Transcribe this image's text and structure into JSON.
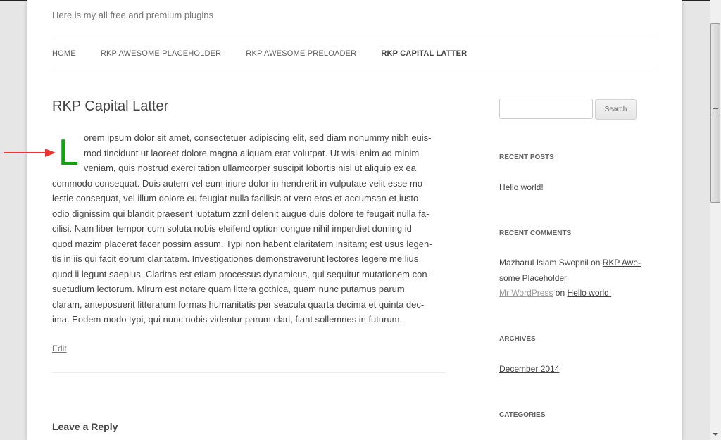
{
  "header": {
    "description": "Here is my all free and premium plugins"
  },
  "nav": {
    "items": [
      "HOME",
      "RKP AWESOME PLACEHOLDER",
      "RKP AWESOME PRELOADER",
      "RKP CAPITAL LATTER"
    ],
    "current": 3
  },
  "post": {
    "title": "RKP Capital Latter",
    "drop_cap": "L",
    "drop_cap_color": "#0aa80a",
    "lines": [
      "orem ipsum dolor sit amet, consectetuer adipiscing elit, sed diam nonummy nibh euis-",
      "mod tincidunt ut laoreet dolore magna aliquam erat volutpat. Ut wisi enim ad minim",
      "veniam, quis nostrud exerci tation ullamcorper suscipit lobortis nisl ut aliquip ex ea",
      "commodo consequat. Duis autem vel eum iriure dolor in hendrerit in vulputate velit esse mo-",
      "lestie consequat, vel illum dolore eu feugiat nulla facilisis at vero eros et accumsan et iusto",
      "odio dignissim qui blandit praesent luptatum zzril delenit augue duis dolore te feugait nulla fa-",
      "cilisi. Nam liber tempor cum soluta nobis eleifend option congue nihil imperdiet doming id",
      "quod mazim placerat facer possim assum. Typi non habent claritatem insitam; est usus legen-",
      "tis in iis qui facit eorum claritatem. Investigationes demonstraverunt lectores legere me lius",
      "quod ii legunt saepius. Claritas est etiam processus dynamicus, qui sequitur mutationem con-",
      "suetudium lectorum. Mirum est notare quam littera gothica, quam nunc putamus parum",
      "claram, anteposuerit litterarum formas humanitatis per seacula quarta decima et quinta dec-",
      "ima. Eodem modo typi, qui nunc nobis videntur parum clari, fiant sollemnes in futurum."
    ],
    "edit": "Edit"
  },
  "comments": {
    "title": "Leave a Reply"
  },
  "sidebar": {
    "search_button": "Search",
    "recent_posts": {
      "title": "RECENT POSTS",
      "items": [
        "Hello world!"
      ]
    },
    "recent_comments": {
      "title": "RECENT COMMENTS",
      "c1_author": "Mazharul Islam Swopnil",
      "on": "on",
      "c1_link_a": "RKP Awe-",
      "c1_link_b": "some Placeholder",
      "c2_author": "Mr WordPress",
      "c2_link": "Hello world!"
    },
    "archives": {
      "title": "ARCHIVES",
      "items": [
        "December 2014"
      ]
    },
    "categories": {
      "title": "CATEGORIES"
    }
  }
}
